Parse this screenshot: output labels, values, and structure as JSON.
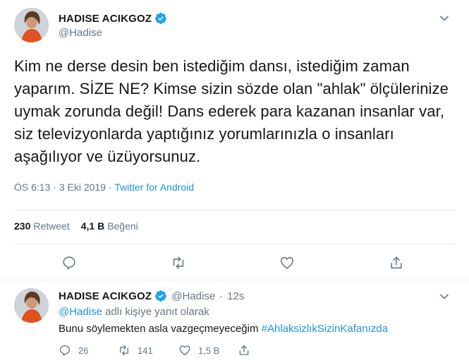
{
  "tweet": {
    "author_name": "HADISE ACIKGOZ",
    "author_handle": "@Hadise",
    "text": "Kim ne derse desin ben istediğim dansı, istediğim zaman yaparım. SİZE NE? Kimse sizin sözde olan \"ahlak\" ölçülerinize uymak zorunda değil! Dans ederek para kazanan insanlar var, siz televizyonlarda yaptığınız yorumlarınızla o insanları aşağılıyor ve üzüyorsunuz.",
    "time": "ÖS 6:13",
    "date": "3 Eki 2019",
    "separator": "·",
    "source": "Twitter for Android",
    "retweet_count": "230",
    "retweet_label": "Retweet",
    "like_count": "4,1 B",
    "like_label": "Beğeni"
  },
  "reply": {
    "author_name": "HADISE ACIKGOZ",
    "author_handle": "@Hadise",
    "separator": "·",
    "time": "12s",
    "reply_to_mention": "@Hadise",
    "reply_to_suffix": "adlı kişiye yanıt olarak",
    "text": "Bunu söylemekten asla vazgeçmeyeceğim",
    "hashtag": "#AhlaksizlıkSizinKafanızda",
    "reply_count": "26",
    "retweet_count": "141",
    "like_count": "1,5 B"
  },
  "icons": {
    "verified": "verified-badge-icon",
    "caret": "chevron-down-icon",
    "reply": "reply-icon",
    "retweet": "retweet-icon",
    "like": "heart-icon",
    "share": "share-icon"
  },
  "colors": {
    "accent": "#1b95e0",
    "text": "#14171a",
    "muted": "#657786",
    "divider": "#e6ecf0"
  }
}
